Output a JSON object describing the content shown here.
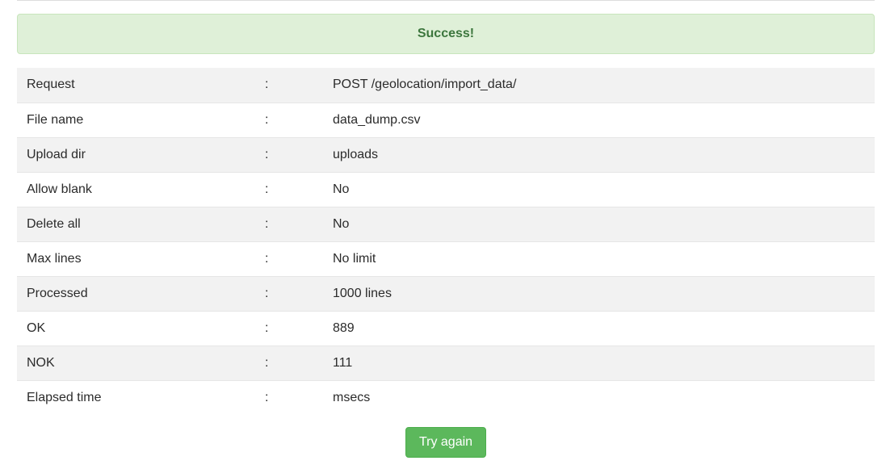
{
  "alert": {
    "message": "Success!"
  },
  "rows": [
    {
      "label": "Request",
      "sep": ":",
      "value": "POST /geolocation/import_data/"
    },
    {
      "label": "File name",
      "sep": ":",
      "value": "data_dump.csv"
    },
    {
      "label": "Upload dir",
      "sep": ":",
      "value": "uploads"
    },
    {
      "label": "Allow blank",
      "sep": ":",
      "value": "No"
    },
    {
      "label": "Delete all",
      "sep": ":",
      "value": "No"
    },
    {
      "label": "Max lines",
      "sep": ":",
      "value": "No limit"
    },
    {
      "label": "Processed",
      "sep": ":",
      "value": "1000 lines"
    },
    {
      "label": "OK",
      "sep": ":",
      "value": "889"
    },
    {
      "label": "NOK",
      "sep": ":",
      "value": "111"
    },
    {
      "label": "Elapsed time",
      "sep": ":",
      "value": "msecs"
    }
  ],
  "actions": {
    "try_again_label": "Try again"
  },
  "colors": {
    "success_bg": "#dff0d8",
    "success_text": "#3c763d",
    "button_bg": "#5cb85c",
    "row_stripe": "#f2f2f2"
  }
}
